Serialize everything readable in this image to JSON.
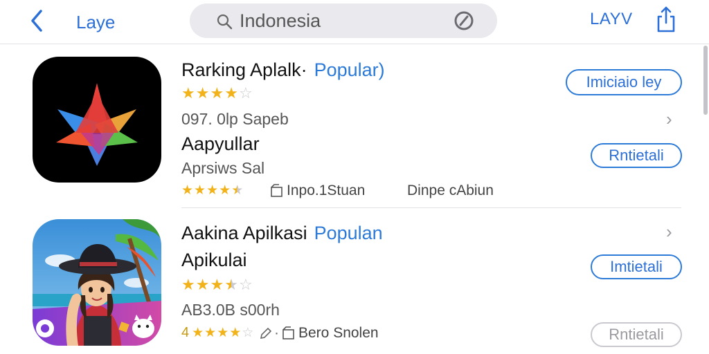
{
  "nav": {
    "back_label": "Laye",
    "search_value": "Indonesia",
    "right_link": "LAYV"
  },
  "apps": [
    {
      "title": "Rarking Aplalk·",
      "tag": "Popular)",
      "rating": 4,
      "info": "097. 0lp Sapeb",
      "name": "Aapyullar",
      "subname": "Aprsiws Sal",
      "rating2": 4.5,
      "meta1": "Inpo.1Stuan",
      "meta2": "Dinpe cAbiun",
      "button_primary": "Imiciaio ley",
      "button_secondary": "Rntietali"
    },
    {
      "title": "Aakina Apilkasi",
      "tag": "Populan",
      "name": "Apikulai",
      "rating": 3.5,
      "info": "AB3.0B s00rh",
      "rating_prefix": "4",
      "rating2": 4,
      "meta1": "Bero Snolen",
      "button_primary": "Imtietali",
      "button_secondary": "Rntietali"
    }
  ],
  "colors": {
    "accent": "#2c7ad8",
    "star": "#f1b21a",
    "star_empty": "#c9c9cf"
  },
  "icons": [
    "chevron-left-icon",
    "search-icon",
    "clear-icon",
    "share-icon",
    "chevron-right-icon",
    "box-icon",
    "edit-icon"
  ]
}
